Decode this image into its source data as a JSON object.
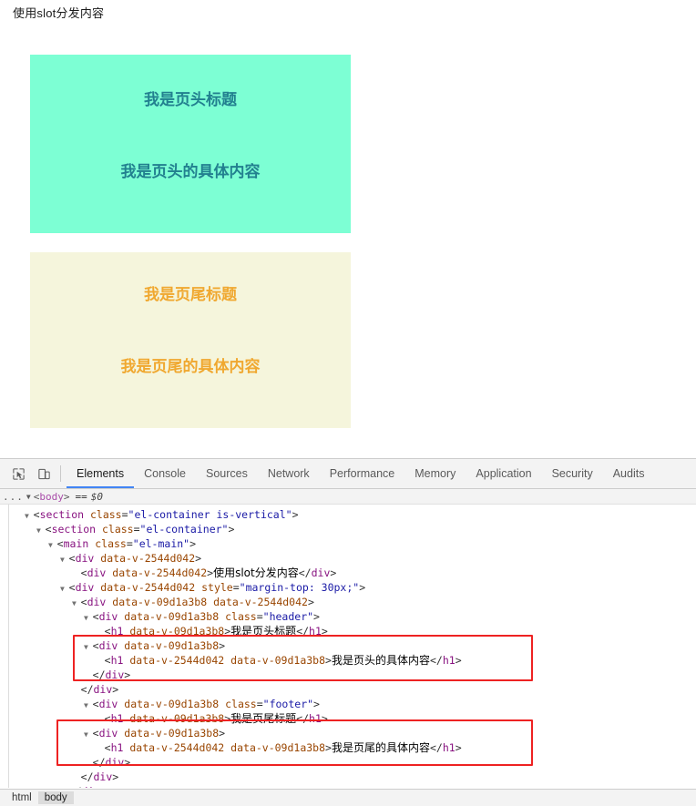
{
  "page": {
    "heading": "使用slot分发内容",
    "header_box": {
      "title": "我是页头标题",
      "body": "我是页头的具体内容",
      "background": "#7dffd4",
      "text_color": "#22808f"
    },
    "footer_box": {
      "title": "我是页尾标题",
      "body": "我是页尾的具体内容",
      "background": "#f5f5dc",
      "text_color": "#f0a830"
    }
  },
  "devtools": {
    "icons": {
      "inspect": "inspect-element-icon",
      "device": "device-toolbar-icon"
    },
    "tabs": [
      {
        "label": "Elements",
        "active": true
      },
      {
        "label": "Console",
        "active": false
      },
      {
        "label": "Sources",
        "active": false
      },
      {
        "label": "Network",
        "active": false
      },
      {
        "label": "Performance",
        "active": false
      },
      {
        "label": "Memory",
        "active": false
      },
      {
        "label": "Application",
        "active": false
      },
      {
        "label": "Security",
        "active": false
      },
      {
        "label": "Audits",
        "active": false
      }
    ],
    "breadcrumb_top": {
      "ellipsis": "...",
      "arrow": "▼",
      "open_angle": "<",
      "tag": "body",
      "close_angle": ">",
      "equals": "==",
      "selection": "$0"
    },
    "dom_lines": [
      {
        "indent": 1,
        "twisty": true,
        "parts": [
          {
            "t": "punc",
            "v": "<"
          },
          {
            "t": "tag",
            "v": "section"
          },
          {
            "t": "punc",
            "v": " "
          },
          {
            "t": "attr",
            "v": "class"
          },
          {
            "t": "punc",
            "v": "="
          },
          {
            "t": "val",
            "v": "\"el-container is-vertical\""
          },
          {
            "t": "punc",
            "v": ">"
          }
        ]
      },
      {
        "indent": 2,
        "twisty": true,
        "parts": [
          {
            "t": "punc",
            "v": "<"
          },
          {
            "t": "tag",
            "v": "section"
          },
          {
            "t": "punc",
            "v": " "
          },
          {
            "t": "attr",
            "v": "class"
          },
          {
            "t": "punc",
            "v": "="
          },
          {
            "t": "val",
            "v": "\"el-container\""
          },
          {
            "t": "punc",
            "v": ">"
          }
        ]
      },
      {
        "indent": 3,
        "twisty": true,
        "parts": [
          {
            "t": "punc",
            "v": "<"
          },
          {
            "t": "tag",
            "v": "main"
          },
          {
            "t": "punc",
            "v": " "
          },
          {
            "t": "attr",
            "v": "class"
          },
          {
            "t": "punc",
            "v": "="
          },
          {
            "t": "val",
            "v": "\"el-main\""
          },
          {
            "t": "punc",
            "v": ">"
          }
        ]
      },
      {
        "indent": 4,
        "twisty": true,
        "parts": [
          {
            "t": "punc",
            "v": "<"
          },
          {
            "t": "tag",
            "v": "div"
          },
          {
            "t": "punc",
            "v": " "
          },
          {
            "t": "attr",
            "v": "data-v-2544d042"
          },
          {
            "t": "punc",
            "v": ">"
          }
        ]
      },
      {
        "indent": 5,
        "twisty": false,
        "parts": [
          {
            "t": "punc",
            "v": "<"
          },
          {
            "t": "tag",
            "v": "div"
          },
          {
            "t": "punc",
            "v": " "
          },
          {
            "t": "attr",
            "v": "data-v-2544d042"
          },
          {
            "t": "punc",
            "v": ">"
          },
          {
            "t": "txt",
            "v": "使用slot分发内容"
          },
          {
            "t": "punc",
            "v": "</"
          },
          {
            "t": "tag",
            "v": "div"
          },
          {
            "t": "punc",
            "v": ">"
          }
        ]
      },
      {
        "indent": 4,
        "twisty": true,
        "parts": [
          {
            "t": "punc",
            "v": "<"
          },
          {
            "t": "tag",
            "v": "div"
          },
          {
            "t": "punc",
            "v": " "
          },
          {
            "t": "attr",
            "v": "data-v-2544d042"
          },
          {
            "t": "punc",
            "v": " "
          },
          {
            "t": "attr",
            "v": "style"
          },
          {
            "t": "punc",
            "v": "="
          },
          {
            "t": "val",
            "v": "\"margin-top: 30px;\""
          },
          {
            "t": "punc",
            "v": ">"
          }
        ]
      },
      {
        "indent": 5,
        "twisty": true,
        "parts": [
          {
            "t": "punc",
            "v": "<"
          },
          {
            "t": "tag",
            "v": "div"
          },
          {
            "t": "punc",
            "v": " "
          },
          {
            "t": "attr",
            "v": "data-v-09d1a3b8"
          },
          {
            "t": "punc",
            "v": " "
          },
          {
            "t": "attr",
            "v": "data-v-2544d042"
          },
          {
            "t": "punc",
            "v": ">"
          }
        ]
      },
      {
        "indent": 6,
        "twisty": true,
        "parts": [
          {
            "t": "punc",
            "v": "<"
          },
          {
            "t": "tag",
            "v": "div"
          },
          {
            "t": "punc",
            "v": " "
          },
          {
            "t": "attr",
            "v": "data-v-09d1a3b8"
          },
          {
            "t": "punc",
            "v": " "
          },
          {
            "t": "attr",
            "v": "class"
          },
          {
            "t": "punc",
            "v": "="
          },
          {
            "t": "val",
            "v": "\"header\""
          },
          {
            "t": "punc",
            "v": ">"
          }
        ]
      },
      {
        "indent": 7,
        "twisty": false,
        "parts": [
          {
            "t": "punc",
            "v": "<"
          },
          {
            "t": "tag",
            "v": "h1"
          },
          {
            "t": "punc",
            "v": " "
          },
          {
            "t": "attr",
            "v": "data-v-09d1a3b8"
          },
          {
            "t": "punc",
            "v": ">"
          },
          {
            "t": "txt",
            "v": "我是页头标题"
          },
          {
            "t": "punc",
            "v": "</"
          },
          {
            "t": "tag",
            "v": "h1"
          },
          {
            "t": "punc",
            "v": ">"
          }
        ]
      },
      {
        "indent": 6,
        "twisty": true,
        "parts": [
          {
            "t": "punc",
            "v": "<"
          },
          {
            "t": "tag",
            "v": "div"
          },
          {
            "t": "punc",
            "v": " "
          },
          {
            "t": "attr",
            "v": "data-v-09d1a3b8"
          },
          {
            "t": "punc",
            "v": ">"
          }
        ]
      },
      {
        "indent": 7,
        "twisty": false,
        "parts": [
          {
            "t": "punc",
            "v": "<"
          },
          {
            "t": "tag",
            "v": "h1"
          },
          {
            "t": "punc",
            "v": " "
          },
          {
            "t": "attr",
            "v": "data-v-2544d042"
          },
          {
            "t": "punc",
            "v": " "
          },
          {
            "t": "attr",
            "v": "data-v-09d1a3b8"
          },
          {
            "t": "punc",
            "v": ">"
          },
          {
            "t": "txt",
            "v": "我是页头的具体内容"
          },
          {
            "t": "punc",
            "v": "</"
          },
          {
            "t": "tag",
            "v": "h1"
          },
          {
            "t": "punc",
            "v": ">"
          }
        ]
      },
      {
        "indent": 6,
        "twisty": false,
        "parts": [
          {
            "t": "punc",
            "v": "</"
          },
          {
            "t": "tag",
            "v": "div"
          },
          {
            "t": "punc",
            "v": ">"
          }
        ]
      },
      {
        "indent": 5,
        "twisty": false,
        "parts": [
          {
            "t": "punc",
            "v": "</"
          },
          {
            "t": "tag",
            "v": "div"
          },
          {
            "t": "punc",
            "v": ">"
          }
        ]
      },
      {
        "indent": 6,
        "twisty": true,
        "parts": [
          {
            "t": "punc",
            "v": "<"
          },
          {
            "t": "tag",
            "v": "div"
          },
          {
            "t": "punc",
            "v": " "
          },
          {
            "t": "attr",
            "v": "data-v-09d1a3b8"
          },
          {
            "t": "punc",
            "v": " "
          },
          {
            "t": "attr",
            "v": "class"
          },
          {
            "t": "punc",
            "v": "="
          },
          {
            "t": "val",
            "v": "\"footer\""
          },
          {
            "t": "punc",
            "v": ">"
          }
        ]
      },
      {
        "indent": 7,
        "twisty": false,
        "parts": [
          {
            "t": "punc",
            "v": "<"
          },
          {
            "t": "tag",
            "v": "h1"
          },
          {
            "t": "punc",
            "v": " "
          },
          {
            "t": "attr",
            "v": "data-v-09d1a3b8"
          },
          {
            "t": "punc",
            "v": ">"
          },
          {
            "t": "txt",
            "v": "我是页尾标题"
          },
          {
            "t": "punc",
            "v": "</"
          },
          {
            "t": "tag",
            "v": "h1"
          },
          {
            "t": "punc",
            "v": ">"
          }
        ]
      },
      {
        "indent": 6,
        "twisty": true,
        "parts": [
          {
            "t": "punc",
            "v": "<"
          },
          {
            "t": "tag",
            "v": "div"
          },
          {
            "t": "punc",
            "v": " "
          },
          {
            "t": "attr",
            "v": "data-v-09d1a3b8"
          },
          {
            "t": "punc",
            "v": ">"
          }
        ]
      },
      {
        "indent": 7,
        "twisty": false,
        "parts": [
          {
            "t": "punc",
            "v": "<"
          },
          {
            "t": "tag",
            "v": "h1"
          },
          {
            "t": "punc",
            "v": " "
          },
          {
            "t": "attr",
            "v": "data-v-2544d042"
          },
          {
            "t": "punc",
            "v": " "
          },
          {
            "t": "attr",
            "v": "data-v-09d1a3b8"
          },
          {
            "t": "punc",
            "v": ">"
          },
          {
            "t": "txt",
            "v": "我是页尾的具体内容"
          },
          {
            "t": "punc",
            "v": "</"
          },
          {
            "t": "tag",
            "v": "h1"
          },
          {
            "t": "punc",
            "v": ">"
          }
        ]
      },
      {
        "indent": 6,
        "twisty": false,
        "parts": [
          {
            "t": "punc",
            "v": "</"
          },
          {
            "t": "tag",
            "v": "div"
          },
          {
            "t": "punc",
            "v": ">"
          }
        ]
      },
      {
        "indent": 5,
        "twisty": false,
        "parts": [
          {
            "t": "punc",
            "v": "</"
          },
          {
            "t": "tag",
            "v": "div"
          },
          {
            "t": "punc",
            "v": ">"
          }
        ]
      },
      {
        "indent": 4,
        "twisty": false,
        "parts": [
          {
            "t": "punc",
            "v": "</"
          },
          {
            "t": "tag",
            "v": "div"
          },
          {
            "t": "punc",
            "v": ">"
          }
        ]
      }
    ],
    "annotations": [
      {
        "name": "header-slot-highlight",
        "color": "#ee2222"
      },
      {
        "name": "footer-slot-highlight",
        "color": "#ee2222"
      }
    ],
    "statusbar_crumbs": [
      {
        "label": "html",
        "selected": false
      },
      {
        "label": "body",
        "selected": true
      }
    ]
  }
}
